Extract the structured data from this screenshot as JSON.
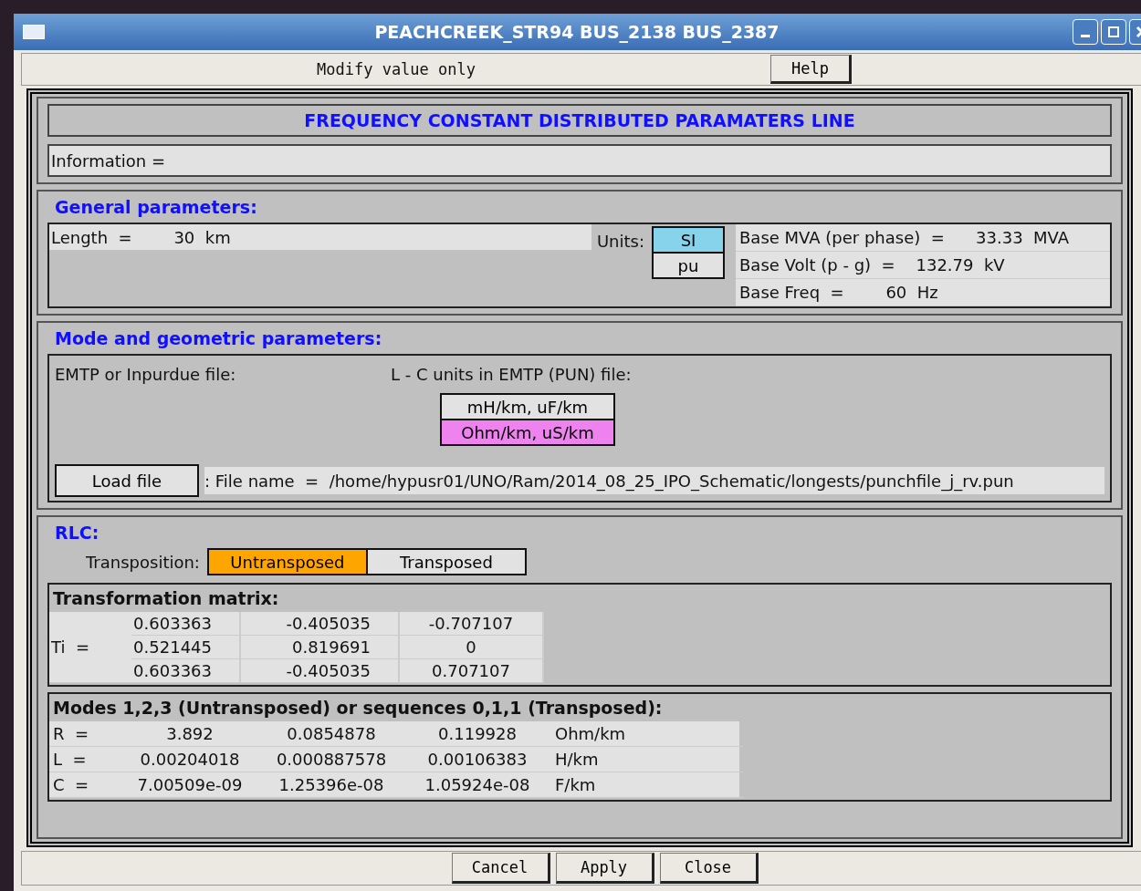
{
  "window": {
    "title": "PEACHCREEK_STR94 BUS_2138 BUS_2387"
  },
  "toolbar": {
    "mode_label": "Modify value only",
    "help_button": "Help"
  },
  "header": {
    "title": "FREQUENCY CONSTANT DISTRIBUTED PARAMATERS LINE",
    "information": "Information  ="
  },
  "general": {
    "title": "General parameters:",
    "length": "Length  =        30  km",
    "units_label": "Units:",
    "units": [
      {
        "label": "SI",
        "selected": true
      },
      {
        "label": "pu",
        "selected": false
      }
    ],
    "base": [
      "Base MVA (per phase)  =      33.33  MVA",
      "Base Volt (p - g)  =    132.79  kV",
      "Base Freq  =        60  Hz"
    ]
  },
  "mode": {
    "title": "Mode and geometric parameters:",
    "emtp_label": "EMTP or Inpurdue file:",
    "lc_label": "L - C units in EMTP (PUN) file:",
    "lc_units": [
      {
        "label": "mH/km, uF/km",
        "selected": false
      },
      {
        "label": "Ohm/km, uS/km",
        "selected": true
      }
    ],
    "load_button": "Load file",
    "file_name": ": File name  =  /home/hypusr01/UNO/Ram/2014_08_25_IPO_Schematic/longests/punchfile_j_rv.pun"
  },
  "rlc": {
    "title": "RLC:",
    "transposition_label": "Transposition:",
    "transposition": [
      {
        "label": "Untransposed",
        "selected": true
      },
      {
        "label": "Transposed",
        "selected": false
      }
    ],
    "matrix": {
      "title": "Transformation matrix:",
      "label": "Ti  =",
      "rows": [
        [
          "0.603363",
          "-0.405035",
          "-0.707107"
        ],
        [
          "0.521445",
          "0.819691",
          "0"
        ],
        [
          "0.603363",
          "-0.405035",
          "0.707107"
        ]
      ]
    },
    "modes": {
      "title": "Modes 1,2,3 (Untransposed) or sequences 0,1,1 (Transposed):",
      "rows": [
        {
          "label": "R  =",
          "values": [
            "3.892",
            "0.0854878",
            "0.119928"
          ],
          "unit": "Ohm/km"
        },
        {
          "label": "L  =",
          "values": [
            "0.00204018",
            "0.000887578",
            "0.00106383"
          ],
          "unit": "H/km"
        },
        {
          "label": "C  =",
          "values": [
            "7.00509e-09",
            "1.25396e-08",
            "1.05924e-08"
          ],
          "unit": "F/km"
        }
      ]
    }
  },
  "buttons": [
    "Cancel",
    "Apply",
    "Close"
  ]
}
